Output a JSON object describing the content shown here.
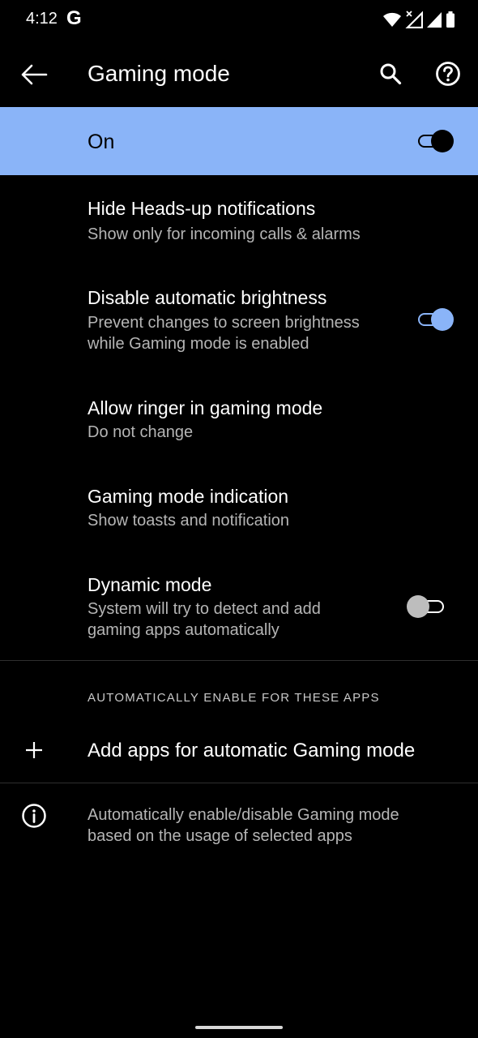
{
  "status_bar": {
    "time": "4:12",
    "carrier_glyph": "G",
    "icons": [
      "wifi-icon",
      "signal-off-icon",
      "signal-icon",
      "battery-icon"
    ]
  },
  "app_bar": {
    "title": "Gaming mode",
    "back_icon": "arrow-back-icon",
    "search_icon": "search-icon",
    "help_icon": "help-icon"
  },
  "master_switch": {
    "label": "On",
    "checked": true
  },
  "preferences": [
    {
      "title": "Hide Heads-up notifications",
      "summary": [
        "Show only for incoming calls & alarms"
      ],
      "has_switch": false
    },
    {
      "title": "Disable automatic brightness",
      "summary": [
        "Prevent changes to screen brightness",
        "while Gaming mode is enabled"
      ],
      "has_switch": true,
      "checked": true
    },
    {
      "title": "Allow ringer in gaming mode",
      "summary": [
        "Do not change"
      ],
      "has_switch": false
    },
    {
      "title": "Gaming mode indication",
      "summary": [
        "Show toasts and notification"
      ],
      "has_switch": false
    },
    {
      "title": "Dynamic mode",
      "summary": [
        "System will try to detect and add",
        "gaming apps automatically"
      ],
      "has_switch": true,
      "checked": false
    }
  ],
  "apps_section": {
    "header": "AUTOMATICALLY ENABLE FOR THESE APPS",
    "add_label": "Add apps for automatic Gaming mode",
    "add_icon": "add-icon"
  },
  "footer_info": {
    "icon": "info-icon",
    "lines": [
      "Automatically enable/disable Gaming mode",
      "based on the usage of selected apps"
    ]
  },
  "colors": {
    "background": "#000000",
    "accent": "#8ab4f8",
    "text_primary": "#ffffff",
    "text_secondary": "#b5b5b5",
    "switch_off_thumb": "#bdbdbd"
  }
}
